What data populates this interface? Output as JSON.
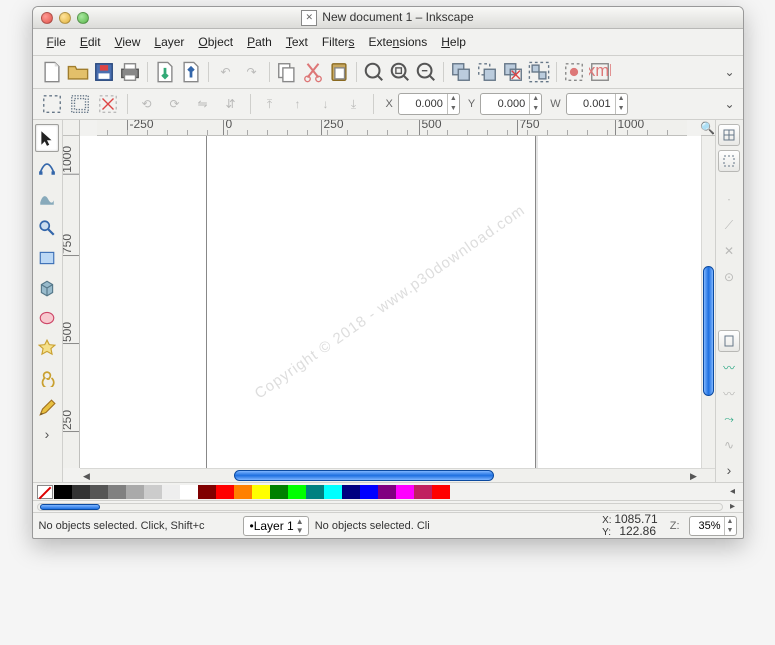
{
  "window": {
    "title": "New document 1 – Inkscape"
  },
  "menu": [
    "File",
    "Edit",
    "View",
    "Layer",
    "Object",
    "Path",
    "Text",
    "Filters",
    "Extensions",
    "Help"
  ],
  "options": {
    "x": "0.000",
    "y": "0.000",
    "w": "0.001"
  },
  "ruler_h": [
    "-250",
    "0",
    "250",
    "500",
    "750",
    "1000"
  ],
  "ruler_v": [
    "1000",
    "750",
    "500",
    "250"
  ],
  "watermark": "Copyright © 2018 - www.p30download.com",
  "palette": [
    "#000000",
    "#333333",
    "#555555",
    "#808080",
    "#aaaaaa",
    "#cccccc",
    "#eeeeee",
    "#ffffff",
    "#800000",
    "#ff0000",
    "#ff8000",
    "#ffff00",
    "#008000",
    "#00ff00",
    "#008080",
    "#00ffff",
    "#000080",
    "#0000ff",
    "#800080",
    "#ff00ff",
    "#c02060",
    "#ff0000"
  ],
  "status": {
    "left_msg": "No objects selected. Click, Shift+c",
    "layer": "•Layer 1",
    "right_msg": "No objects selected. Cli",
    "coord_x": "1085.71",
    "coord_y": "122.86",
    "zoom": "35%"
  }
}
